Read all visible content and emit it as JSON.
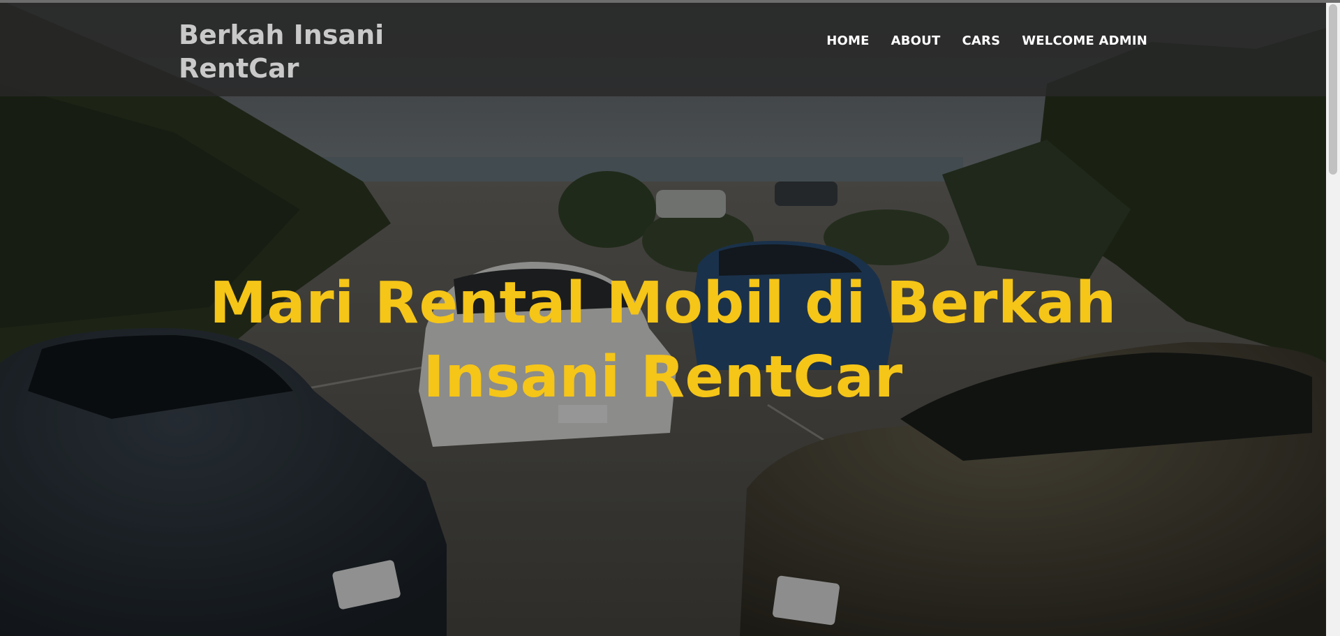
{
  "navbar": {
    "brand": "Berkah Insani RentCar",
    "links": [
      {
        "label": "HOME"
      },
      {
        "label": "ABOUT"
      },
      {
        "label": "CARS"
      },
      {
        "label": "WELCOME ADMIN"
      }
    ]
  },
  "hero": {
    "title": "Mari Rental Mobil di Berkah Insani RentCar",
    "background_image": "parking lot with cars by the sea"
  },
  "colors": {
    "navbar_bg": "#282828",
    "brand_text": "#c9c9c9",
    "nav_text": "#ffffff",
    "hero_title": "#f5c518"
  }
}
